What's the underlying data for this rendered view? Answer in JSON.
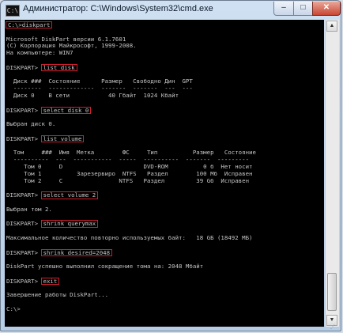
{
  "window": {
    "title": "Администратор: C:\\Windows\\System32\\cmd.exe",
    "icon_label": "C:\\",
    "controls": {
      "minimize": "–",
      "maximize": "□",
      "close": "✕"
    }
  },
  "console": {
    "lines": [
      {
        "cmd": "C:\\>diskpart"
      },
      {
        "text": ""
      },
      {
        "text": "Microsoft DiskPart версии 6.1.7601"
      },
      {
        "text": "(C) Корпорация Майкрософт, 1999-2008."
      },
      {
        "text": "На компьютере: WIN7"
      },
      {
        "text": ""
      },
      {
        "prompt": "DISKPART> ",
        "cmd": "list disk"
      },
      {
        "text": ""
      },
      {
        "text": "  Диск ###  Состояние      Размер   Свободно Дин  GPT"
      },
      {
        "text": "  --------  -------------  -------  -------  ---  ---"
      },
      {
        "text": "  Диск 0    В сети           40 Гбайт  1024 Кбайт"
      },
      {
        "text": ""
      },
      {
        "prompt": "DISKPART> ",
        "cmd": "select disk 0"
      },
      {
        "text": ""
      },
      {
        "text": "Выбран диск 0."
      },
      {
        "text": ""
      },
      {
        "prompt": "DISKPART> ",
        "cmd": "list volume"
      },
      {
        "text": ""
      },
      {
        "text": "  Том     ###  Имя  Метка        ФС     Тип          Размер   Состояние"
      },
      {
        "text": "  ----------  ---  -----------  -----  ----------  -------  ---------"
      },
      {
        "text": "     Том 0     D                       DVD-ROM          0 б  Нет носит"
      },
      {
        "text": "     Том 1          Зарезервиро  NTFS   Раздел        100 Мб  Исправен"
      },
      {
        "text": "     Том 2     C                NTFS   Раздел         39 Gб  Исправен"
      },
      {
        "text": ""
      },
      {
        "prompt": "DISKPART> ",
        "cmd": "select volume 2"
      },
      {
        "text": ""
      },
      {
        "text": "Выбран том 2."
      },
      {
        "text": ""
      },
      {
        "prompt": "DISKPART> ",
        "cmd": "shrink querymax"
      },
      {
        "text": ""
      },
      {
        "text": "Максимальное количество повторно используемых байт:   18 GБ (18492 МБ)"
      },
      {
        "text": ""
      },
      {
        "prompt": "DISKPART> ",
        "cmd": "shrink desired=2048"
      },
      {
        "text": ""
      },
      {
        "text": "DiskPart успешно выполнил сокращение тома на: 2048 Мбайт"
      },
      {
        "text": ""
      },
      {
        "prompt": "DISKPART> ",
        "cmd": "exit"
      },
      {
        "text": ""
      },
      {
        "text": "Завершение работы DiskPart..."
      },
      {
        "text": ""
      },
      {
        "text": "C:\\>"
      }
    ]
  },
  "scrollbar": {
    "up": "▲",
    "down": "▼"
  }
}
